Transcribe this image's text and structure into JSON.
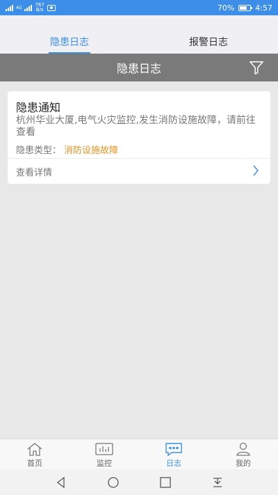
{
  "status_bar": {
    "network": "4G",
    "speed": "767",
    "speed_unit": "B/s",
    "battery": "70%",
    "battery_level": 0.7,
    "time": "4:57"
  },
  "tabs": [
    {
      "label": "隐患日志",
      "active": true
    },
    {
      "label": "报警日志",
      "active": false
    }
  ],
  "title_bar": {
    "title": "隐患日志"
  },
  "card": {
    "title": "隐患通知",
    "body": "杭州华业大厦,电气火灾监控,发生消防设施故障，请前往查看",
    "type_label": "隐患类型：",
    "type_value": "消防设施故障",
    "detail_label": "查看详情"
  },
  "bottom_nav": [
    {
      "label": "首页",
      "icon": "home-icon"
    },
    {
      "label": "监控",
      "icon": "monitor-icon"
    },
    {
      "label": "日志",
      "icon": "log-icon",
      "active": true
    },
    {
      "label": "我的",
      "icon": "user-icon"
    }
  ],
  "colors": {
    "accent": "#3b8fe0",
    "status_bar": "#3d8ee8",
    "title_bar": "#7a7a7a",
    "warning": "#e8911e"
  }
}
